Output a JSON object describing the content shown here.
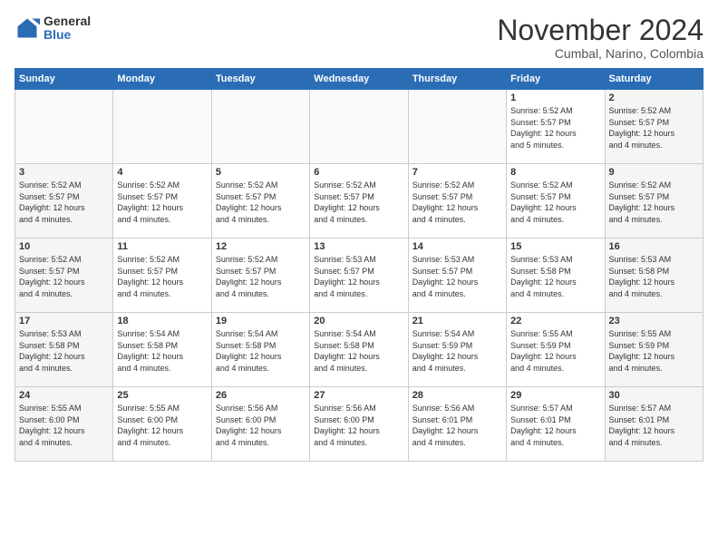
{
  "logo": {
    "general": "General",
    "blue": "Blue"
  },
  "header": {
    "title": "November 2024",
    "subtitle": "Cumbal, Narino, Colombia"
  },
  "weekdays": [
    "Sunday",
    "Monday",
    "Tuesday",
    "Wednesday",
    "Thursday",
    "Friday",
    "Saturday"
  ],
  "weeks": [
    [
      {
        "day": "",
        "info": ""
      },
      {
        "day": "",
        "info": ""
      },
      {
        "day": "",
        "info": ""
      },
      {
        "day": "",
        "info": ""
      },
      {
        "day": "",
        "info": ""
      },
      {
        "day": "1",
        "info": "Sunrise: 5:52 AM\nSunset: 5:57 PM\nDaylight: 12 hours\nand 5 minutes."
      },
      {
        "day": "2",
        "info": "Sunrise: 5:52 AM\nSunset: 5:57 PM\nDaylight: 12 hours\nand 4 minutes."
      }
    ],
    [
      {
        "day": "3",
        "info": "Sunrise: 5:52 AM\nSunset: 5:57 PM\nDaylight: 12 hours\nand 4 minutes."
      },
      {
        "day": "4",
        "info": "Sunrise: 5:52 AM\nSunset: 5:57 PM\nDaylight: 12 hours\nand 4 minutes."
      },
      {
        "day": "5",
        "info": "Sunrise: 5:52 AM\nSunset: 5:57 PM\nDaylight: 12 hours\nand 4 minutes."
      },
      {
        "day": "6",
        "info": "Sunrise: 5:52 AM\nSunset: 5:57 PM\nDaylight: 12 hours\nand 4 minutes."
      },
      {
        "day": "7",
        "info": "Sunrise: 5:52 AM\nSunset: 5:57 PM\nDaylight: 12 hours\nand 4 minutes."
      },
      {
        "day": "8",
        "info": "Sunrise: 5:52 AM\nSunset: 5:57 PM\nDaylight: 12 hours\nand 4 minutes."
      },
      {
        "day": "9",
        "info": "Sunrise: 5:52 AM\nSunset: 5:57 PM\nDaylight: 12 hours\nand 4 minutes."
      }
    ],
    [
      {
        "day": "10",
        "info": "Sunrise: 5:52 AM\nSunset: 5:57 PM\nDaylight: 12 hours\nand 4 minutes."
      },
      {
        "day": "11",
        "info": "Sunrise: 5:52 AM\nSunset: 5:57 PM\nDaylight: 12 hours\nand 4 minutes."
      },
      {
        "day": "12",
        "info": "Sunrise: 5:52 AM\nSunset: 5:57 PM\nDaylight: 12 hours\nand 4 minutes."
      },
      {
        "day": "13",
        "info": "Sunrise: 5:53 AM\nSunset: 5:57 PM\nDaylight: 12 hours\nand 4 minutes."
      },
      {
        "day": "14",
        "info": "Sunrise: 5:53 AM\nSunset: 5:57 PM\nDaylight: 12 hours\nand 4 minutes."
      },
      {
        "day": "15",
        "info": "Sunrise: 5:53 AM\nSunset: 5:58 PM\nDaylight: 12 hours\nand 4 minutes."
      },
      {
        "day": "16",
        "info": "Sunrise: 5:53 AM\nSunset: 5:58 PM\nDaylight: 12 hours\nand 4 minutes."
      }
    ],
    [
      {
        "day": "17",
        "info": "Sunrise: 5:53 AM\nSunset: 5:58 PM\nDaylight: 12 hours\nand 4 minutes."
      },
      {
        "day": "18",
        "info": "Sunrise: 5:54 AM\nSunset: 5:58 PM\nDaylight: 12 hours\nand 4 minutes."
      },
      {
        "day": "19",
        "info": "Sunrise: 5:54 AM\nSunset: 5:58 PM\nDaylight: 12 hours\nand 4 minutes."
      },
      {
        "day": "20",
        "info": "Sunrise: 5:54 AM\nSunset: 5:58 PM\nDaylight: 12 hours\nand 4 minutes."
      },
      {
        "day": "21",
        "info": "Sunrise: 5:54 AM\nSunset: 5:59 PM\nDaylight: 12 hours\nand 4 minutes."
      },
      {
        "day": "22",
        "info": "Sunrise: 5:55 AM\nSunset: 5:59 PM\nDaylight: 12 hours\nand 4 minutes."
      },
      {
        "day": "23",
        "info": "Sunrise: 5:55 AM\nSunset: 5:59 PM\nDaylight: 12 hours\nand 4 minutes."
      }
    ],
    [
      {
        "day": "24",
        "info": "Sunrise: 5:55 AM\nSunset: 6:00 PM\nDaylight: 12 hours\nand 4 minutes."
      },
      {
        "day": "25",
        "info": "Sunrise: 5:55 AM\nSunset: 6:00 PM\nDaylight: 12 hours\nand 4 minutes."
      },
      {
        "day": "26",
        "info": "Sunrise: 5:56 AM\nSunset: 6:00 PM\nDaylight: 12 hours\nand 4 minutes."
      },
      {
        "day": "27",
        "info": "Sunrise: 5:56 AM\nSunset: 6:00 PM\nDaylight: 12 hours\nand 4 minutes."
      },
      {
        "day": "28",
        "info": "Sunrise: 5:56 AM\nSunset: 6:01 PM\nDaylight: 12 hours\nand 4 minutes."
      },
      {
        "day": "29",
        "info": "Sunrise: 5:57 AM\nSunset: 6:01 PM\nDaylight: 12 hours\nand 4 minutes."
      },
      {
        "day": "30",
        "info": "Sunrise: 5:57 AM\nSunset: 6:01 PM\nDaylight: 12 hours\nand 4 minutes."
      }
    ]
  ]
}
